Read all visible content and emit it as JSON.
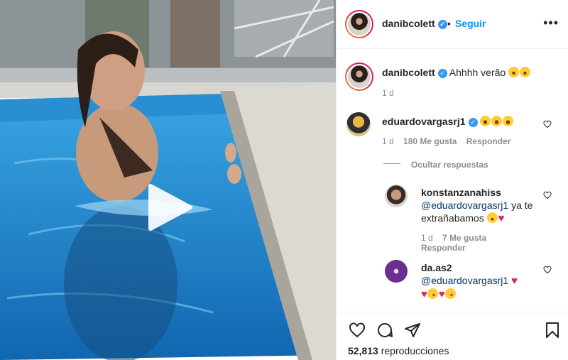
{
  "post": {
    "username": "danibcolett",
    "follow_label": "Seguir",
    "separator": "•",
    "more_label": "•••",
    "caption": "Ahhhh verão",
    "caption_age": "1 d"
  },
  "comments": [
    {
      "username": "eduardovargasrj1",
      "age": "1 d",
      "likes": "180 Me gusta",
      "reply_label": "Responder",
      "toggle_label": "Ocultar respuestas"
    }
  ],
  "replies": [
    {
      "username": "konstanzanahiss",
      "mention": "@eduardovargasrj1",
      "text_line1": "ya te",
      "text_line2": "extrañabamos",
      "age": "1 d",
      "likes": "7 Me gusta",
      "reply_label": "Responder"
    },
    {
      "username": "da.as2",
      "mention": "@eduardovargasrj1"
    }
  ],
  "footer": {
    "views_count": "52,813",
    "views_label": "reproducciones"
  },
  "icons": {
    "like": "heart-icon",
    "comment": "comment-icon",
    "share": "share-icon",
    "save": "bookmark-icon",
    "play": "play-icon",
    "more": "more-options-icon"
  },
  "colors": {
    "link": "#0095f6",
    "verified": "#3897f0",
    "text": "#262626",
    "muted": "#8e8e8e",
    "pool": "#1f86c9"
  }
}
